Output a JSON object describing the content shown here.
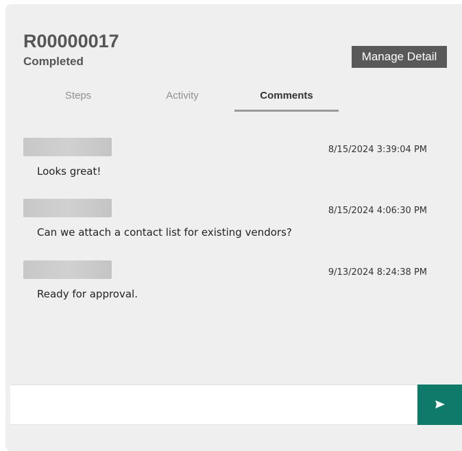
{
  "record": {
    "id": "R00000017",
    "status": "Completed"
  },
  "header": {
    "manage_label": "Manage Detail"
  },
  "tabs": [
    {
      "label": "Steps",
      "active": false
    },
    {
      "label": "Activity",
      "active": false
    },
    {
      "label": "Comments",
      "active": true
    }
  ],
  "comments": [
    {
      "author": "",
      "timestamp": "8/15/2024 3:39:04 PM",
      "text": "Looks great!"
    },
    {
      "author": "",
      "timestamp": "8/15/2024 4:06:30 PM",
      "text": "Can we attach a contact list for existing vendors?"
    },
    {
      "author": "",
      "timestamp": "9/13/2024 8:24:38 PM",
      "text": "Ready for approval."
    }
  ],
  "composer": {
    "value": "",
    "placeholder": "",
    "send_icon": "send-arrow-icon"
  },
  "colors": {
    "panel_bg": "#efefef",
    "manage_button_bg": "#595959",
    "send_button_bg": "#0f7a6a",
    "active_tab_underline": "#9a9a9a"
  }
}
